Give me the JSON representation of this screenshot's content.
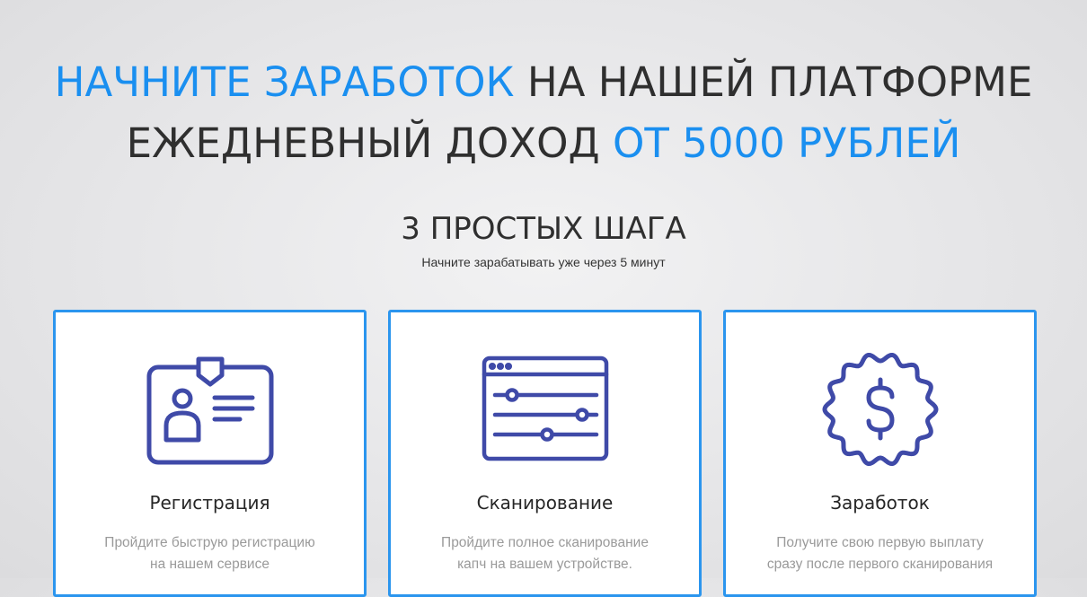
{
  "hero": {
    "line1_highlight": "НАЧНИТЕ ЗАРАБОТОК",
    "line1_rest": " НА НАШЕЙ ПЛАТФОРМЕ",
    "line2_start": "ЕЖЕДНЕВНЫЙ ДОХОД ",
    "line2_highlight": "ОТ 5000 РУБЛЕЙ"
  },
  "steps": {
    "title": "3 ПРОСТЫХ ШАГА",
    "subtitle": "Начните зарабатывать уже через 5 минут",
    "cards": [
      {
        "icon": "id-card-icon",
        "title": "Регистрация",
        "desc_line1": "Пройдите быструю регистрацию",
        "desc_line2": "на нашем сервисе"
      },
      {
        "icon": "sliders-window-icon",
        "title": "Сканирование",
        "desc_line1": "Пройдите полное сканирование",
        "desc_line2": "капч на вашем устройстве."
      },
      {
        "icon": "dollar-badge-icon",
        "title": "Заработок",
        "desc_line1": "Получите свою первую выплату",
        "desc_line2": "сразу после первого сканирования"
      }
    ]
  },
  "colors": {
    "accent": "#1a8ff0",
    "card_border": "#2b95ee",
    "icon": "#3f4aa8",
    "text": "#2f2f2f",
    "muted": "#9a9a9a"
  }
}
